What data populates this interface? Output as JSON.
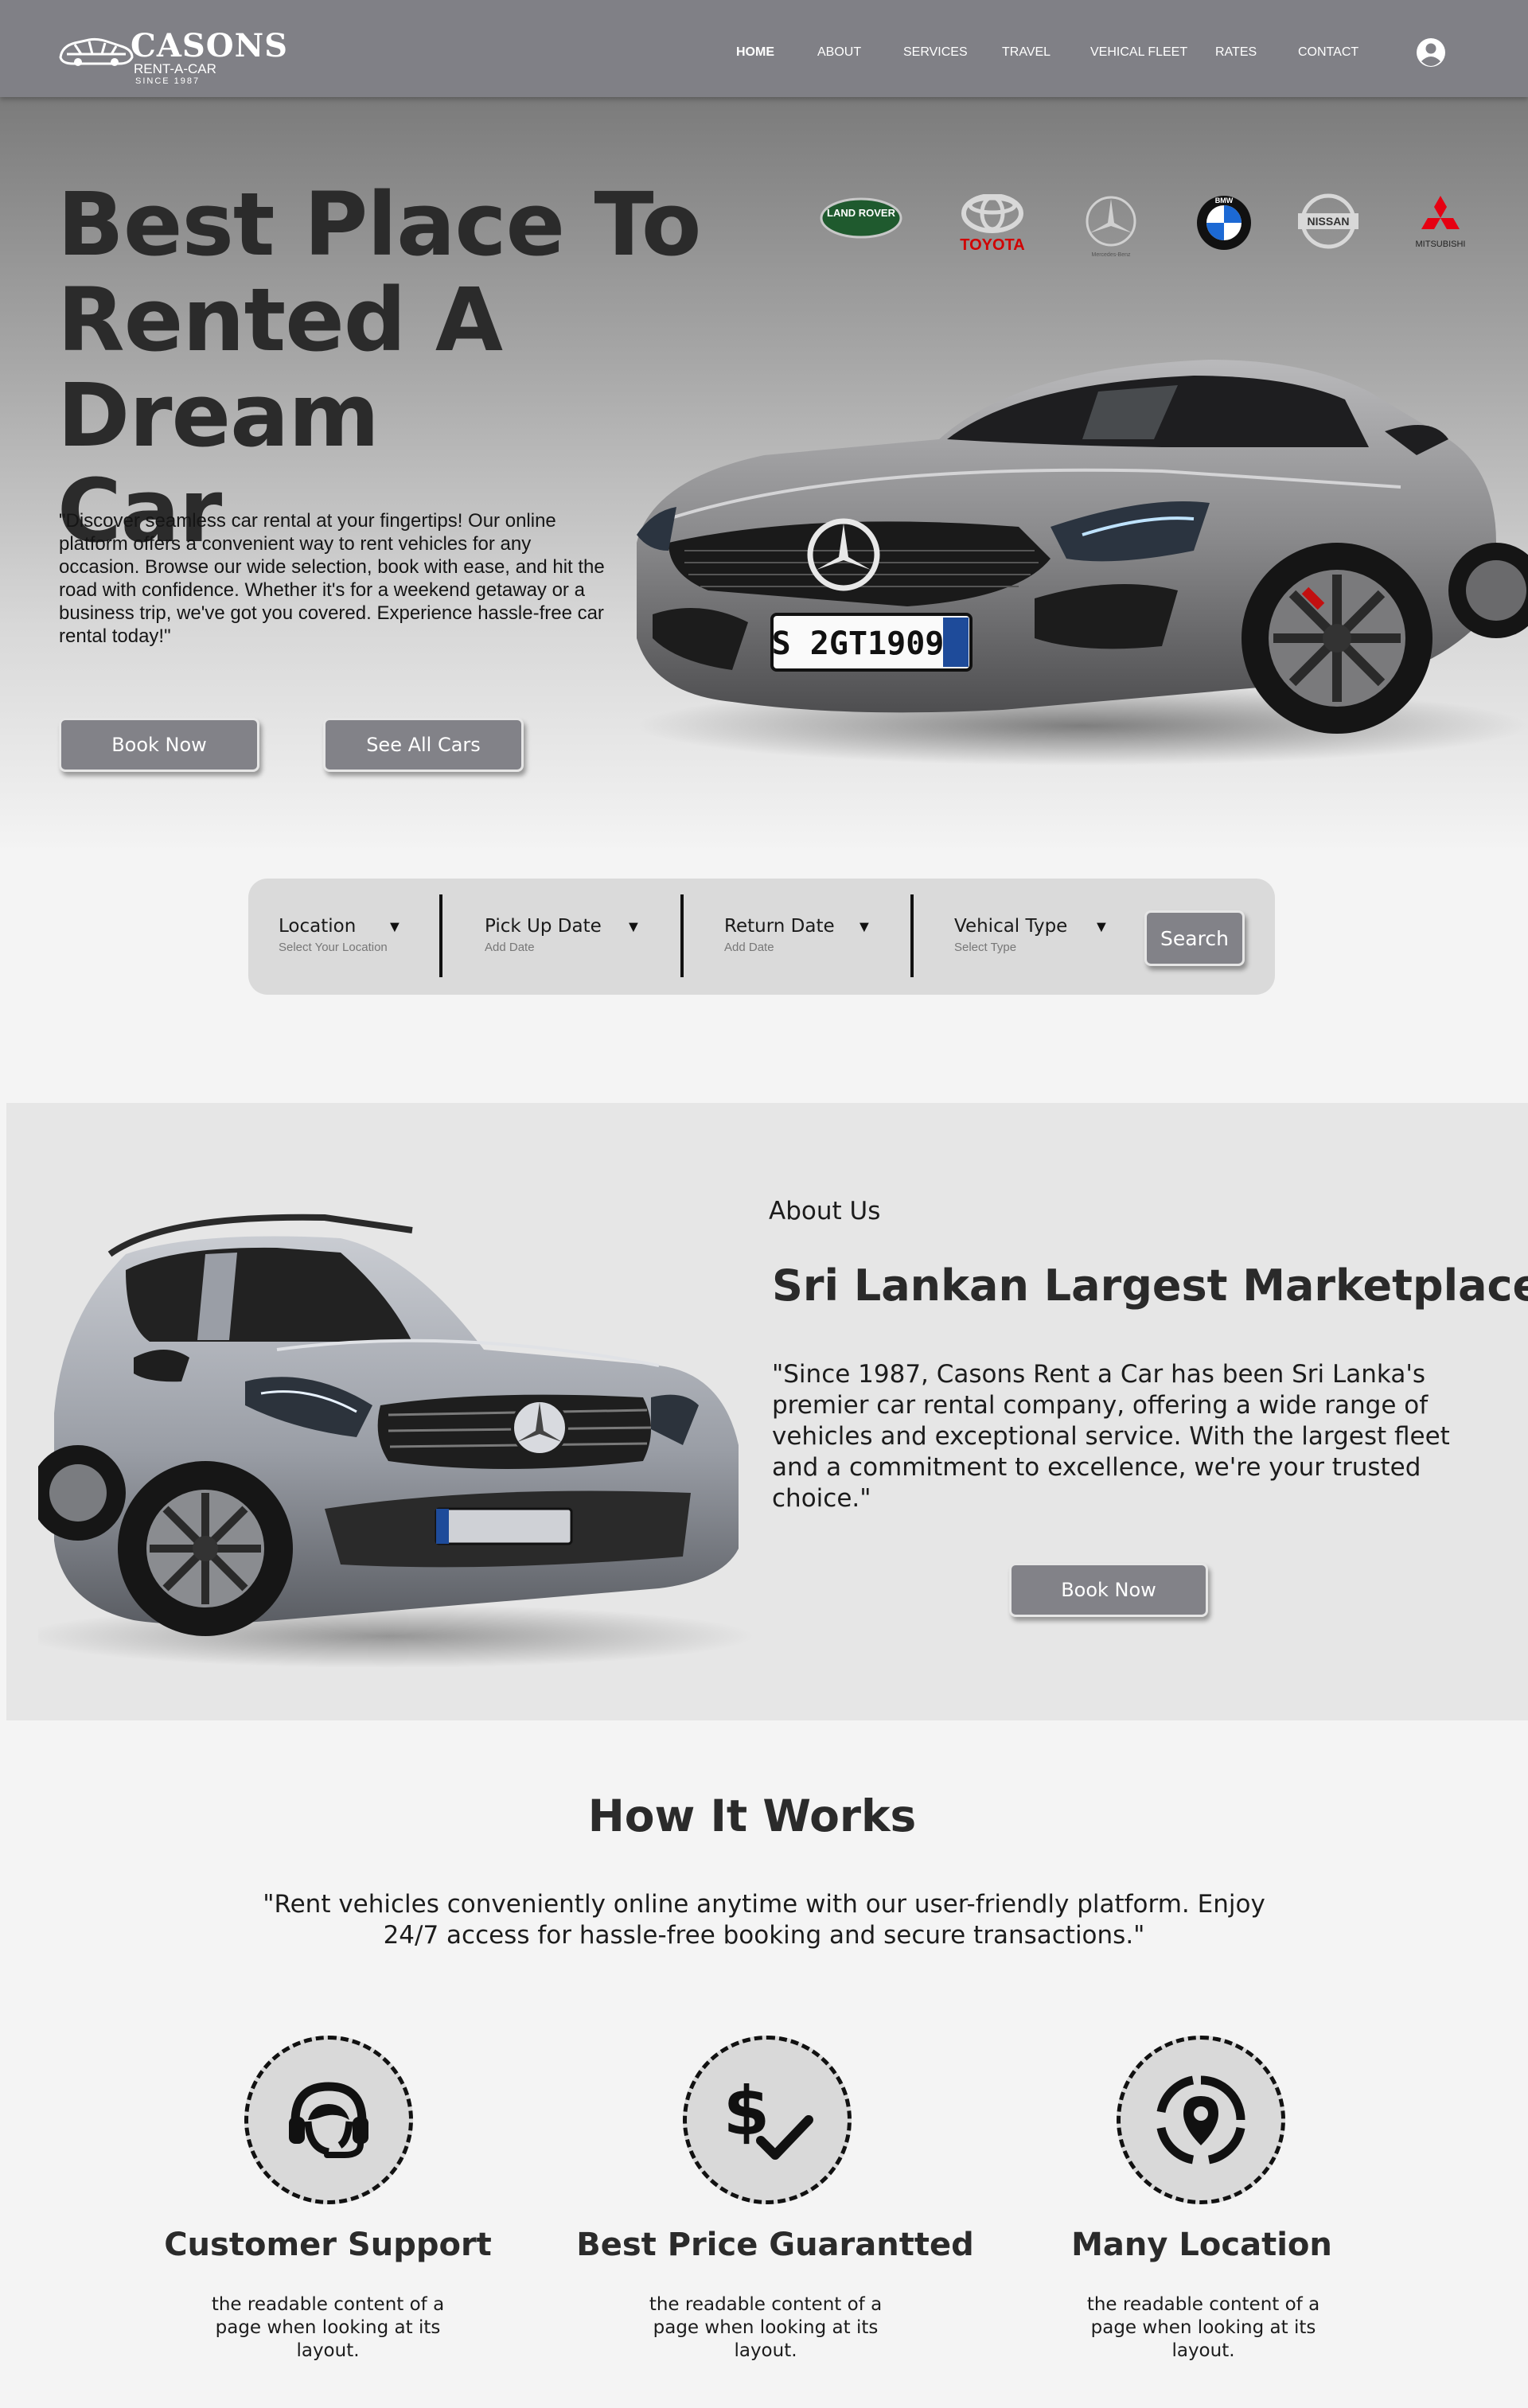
{
  "nav": {
    "logo": {
      "name": "CASONS",
      "sub": "RENT-A-CAR",
      "since": "SINCE 1987"
    },
    "links": [
      {
        "label": "HOME",
        "active": true
      },
      {
        "label": "ABOUT"
      },
      {
        "label": "SERVICES"
      },
      {
        "label": "TRAVEL"
      },
      {
        "label": "VEHICAL FLEET"
      },
      {
        "label": "RATES"
      },
      {
        "label": "CONTACT"
      }
    ],
    "user_icon": "user-circle-icon"
  },
  "hero": {
    "title_lines": [
      "Best Place To",
      "Rented A Dream",
      "Car"
    ],
    "text": "\"Discover seamless car rental at your fingertips! Our online platform offers a convenient way to rent vehicles for any occasion. Browse our wide selection, book with ease, and hit the road with confidence. Whether it's for a weekend getaway or a business trip, we've got you covered. Experience hassle-free car rental today!\"",
    "book_label": "Book Now",
    "see_all_label": "See All Cars",
    "brands": [
      "LAND ROVER",
      "TOYOTA",
      "Mercedes-Benz",
      "BMW",
      "NISSAN",
      "MITSUBISHI"
    ],
    "plate_text": "S 2GT1909"
  },
  "search": {
    "fields": [
      {
        "label": "Location",
        "sub": "Select Your Location"
      },
      {
        "label": "Pick Up Date",
        "sub": "Add Date"
      },
      {
        "label": "Return Date",
        "sub": "Add Date"
      },
      {
        "label": "Vehical Type",
        "sub": "Select Type"
      }
    ],
    "button_label": "Search"
  },
  "about": {
    "kicker": "About Us",
    "title": "Sri Lankan Largest Marketplace",
    "text": "\"Since 1987, Casons Rent a Car has been Sri Lanka's premier car rental company, offering a wide range of vehicles and exceptional service. With the largest fleet and a commitment to excellence, we're your trusted choice.\"",
    "button_label": "Book Now"
  },
  "how": {
    "title": "How It Works",
    "text": "\"Rent vehicles conveniently online anytime with our user-friendly platform. Enjoy 24/7 access for hassle-free booking and secure transactions.\"",
    "features": [
      {
        "icon": "headset-support-icon",
        "title": "Customer Support",
        "text": "the readable content of a page when looking at its layout."
      },
      {
        "icon": "price-check-icon",
        "title": "Best Price Guarantted",
        "text": "the readable content of a page when looking at its layout."
      },
      {
        "icon": "location-pin-icon",
        "title": "Many Location",
        "text": "the readable content of a page when looking at its layout."
      }
    ]
  },
  "colors": {
    "nav_bg": "#808086",
    "button_bg": "#828288",
    "page_bg": "#f4f4f4",
    "panel_bg": "#dadada",
    "about_bg": "#e6e6e6",
    "text_dark": "#2b2b2b"
  }
}
